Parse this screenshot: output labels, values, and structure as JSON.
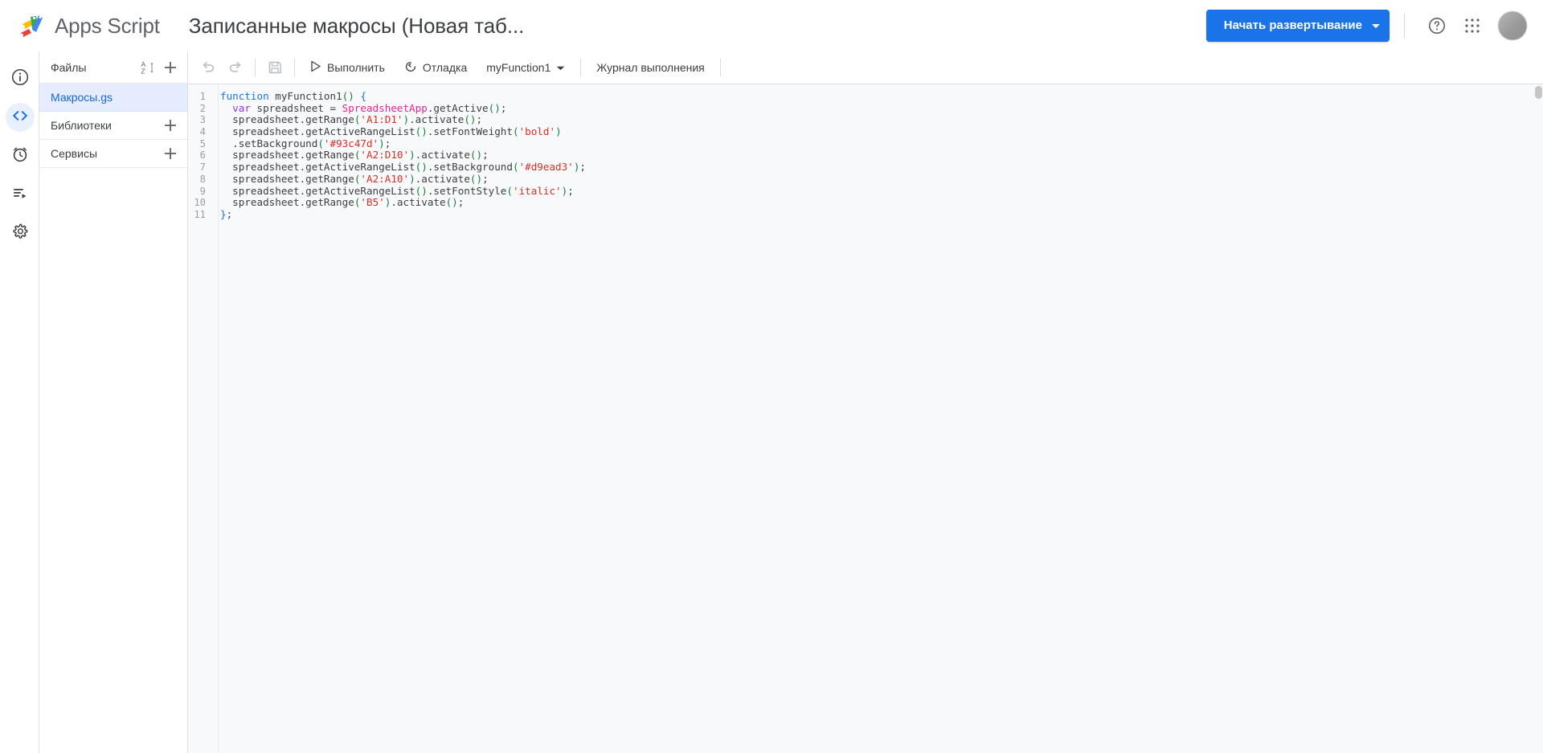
{
  "topbar": {
    "brand": "Apps Script",
    "doc_title": "Записанные макросы (Новая таб...",
    "deploy_label": "Начать развертывание",
    "help_icon": "help-circle-icon",
    "apps_icon": "apps-grid-icon",
    "avatar_label": "account-avatar",
    "accent_color": "#1a73e8"
  },
  "rail": {
    "items": [
      {
        "icon": "info-icon",
        "name": "overview",
        "active": false
      },
      {
        "icon": "code-icon",
        "name": "editor",
        "active": true
      },
      {
        "icon": "clock-icon",
        "name": "triggers",
        "active": false
      },
      {
        "icon": "executions-icon",
        "name": "executions",
        "active": false
      },
      {
        "icon": "gear-icon",
        "name": "settings",
        "active": false
      }
    ]
  },
  "filepanel": {
    "header": {
      "title": "Файлы",
      "sort_icon": "sort-az-icon",
      "add_icon": "plus-icon"
    },
    "files": [
      {
        "name": "Макросы.gs",
        "selected": true
      }
    ],
    "sections": [
      {
        "title": "Библиотеки",
        "add_icon": "plus-icon"
      },
      {
        "title": "Сервисы",
        "add_icon": "plus-icon"
      }
    ]
  },
  "toolbar": {
    "undo_icon": "undo-icon",
    "redo_icon": "redo-icon",
    "save_icon": "save-icon",
    "run_label": "Выполнить",
    "run_icon": "play-icon",
    "debug_label": "Отладка",
    "debug_icon": "debug-icon",
    "function_select": "myFunction1",
    "function_caret": "chevron-down-icon",
    "log_label": "Журнал выполнения"
  },
  "editor": {
    "line_numbers": [
      "1",
      "2",
      "3",
      "4",
      "5",
      "6",
      "7",
      "8",
      "9",
      "10",
      "11"
    ],
    "code_lines": [
      [
        {
          "t": "function",
          "c": "k-keyword"
        },
        {
          "t": " myFunction1",
          "c": "k-plain"
        },
        {
          "t": "()",
          "c": "k-paren"
        },
        {
          "t": " ",
          "c": "k-plain"
        },
        {
          "t": "{",
          "c": "k-brace"
        }
      ],
      [
        {
          "t": "  ",
          "c": "k-plain"
        },
        {
          "t": "var",
          "c": "k-var"
        },
        {
          "t": " spreadsheet = ",
          "c": "k-plain"
        },
        {
          "t": "SpreadsheetApp",
          "c": "k-class"
        },
        {
          "t": ".getActive",
          "c": "k-plain"
        },
        {
          "t": "()",
          "c": "k-paren"
        },
        {
          "t": ";",
          "c": "k-plain"
        }
      ],
      [
        {
          "t": "  spreadsheet.getRange",
          "c": "k-plain"
        },
        {
          "t": "(",
          "c": "k-paren"
        },
        {
          "t": "'A1:D1'",
          "c": "k-string"
        },
        {
          "t": ")",
          "c": "k-paren"
        },
        {
          "t": ".activate",
          "c": "k-plain"
        },
        {
          "t": "()",
          "c": "k-paren"
        },
        {
          "t": ";",
          "c": "k-plain"
        }
      ],
      [
        {
          "t": "  spreadsheet.getActiveRangeList",
          "c": "k-plain"
        },
        {
          "t": "()",
          "c": "k-paren"
        },
        {
          "t": ".setFontWeight",
          "c": "k-plain"
        },
        {
          "t": "(",
          "c": "k-paren"
        },
        {
          "t": "'bold'",
          "c": "k-string"
        },
        {
          "t": ")",
          "c": "k-paren"
        }
      ],
      [
        {
          "t": "  .setBackground",
          "c": "k-plain"
        },
        {
          "t": "(",
          "c": "k-paren"
        },
        {
          "t": "'#93c47d'",
          "c": "k-string"
        },
        {
          "t": ")",
          "c": "k-paren"
        },
        {
          "t": ";",
          "c": "k-plain"
        }
      ],
      [
        {
          "t": "  spreadsheet.getRange",
          "c": "k-plain"
        },
        {
          "t": "(",
          "c": "k-paren"
        },
        {
          "t": "'A2:D10'",
          "c": "k-string"
        },
        {
          "t": ")",
          "c": "k-paren"
        },
        {
          "t": ".activate",
          "c": "k-plain"
        },
        {
          "t": "()",
          "c": "k-paren"
        },
        {
          "t": ";",
          "c": "k-plain"
        }
      ],
      [
        {
          "t": "  spreadsheet.getActiveRangeList",
          "c": "k-plain"
        },
        {
          "t": "()",
          "c": "k-paren"
        },
        {
          "t": ".setBackground",
          "c": "k-plain"
        },
        {
          "t": "(",
          "c": "k-paren"
        },
        {
          "t": "'#d9ead3'",
          "c": "k-string"
        },
        {
          "t": ")",
          "c": "k-paren"
        },
        {
          "t": ";",
          "c": "k-plain"
        }
      ],
      [
        {
          "t": "  spreadsheet.getRange",
          "c": "k-plain"
        },
        {
          "t": "(",
          "c": "k-paren"
        },
        {
          "t": "'A2:A10'",
          "c": "k-string"
        },
        {
          "t": ")",
          "c": "k-paren"
        },
        {
          "t": ".activate",
          "c": "k-plain"
        },
        {
          "t": "()",
          "c": "k-paren"
        },
        {
          "t": ";",
          "c": "k-plain"
        }
      ],
      [
        {
          "t": "  spreadsheet.getActiveRangeList",
          "c": "k-plain"
        },
        {
          "t": "()",
          "c": "k-paren"
        },
        {
          "t": ".setFontStyle",
          "c": "k-plain"
        },
        {
          "t": "(",
          "c": "k-paren"
        },
        {
          "t": "'italic'",
          "c": "k-string"
        },
        {
          "t": ")",
          "c": "k-paren"
        },
        {
          "t": ";",
          "c": "k-plain"
        }
      ],
      [
        {
          "t": "  spreadsheet.getRange",
          "c": "k-plain"
        },
        {
          "t": "(",
          "c": "k-paren"
        },
        {
          "t": "'B5'",
          "c": "k-string"
        },
        {
          "t": ")",
          "c": "k-paren"
        },
        {
          "t": ".activate",
          "c": "k-plain"
        },
        {
          "t": "()",
          "c": "k-paren"
        },
        {
          "t": ";",
          "c": "k-plain"
        }
      ],
      [
        {
          "t": "}",
          "c": "k-brace"
        },
        {
          "t": ";",
          "c": "k-plain"
        }
      ]
    ]
  }
}
